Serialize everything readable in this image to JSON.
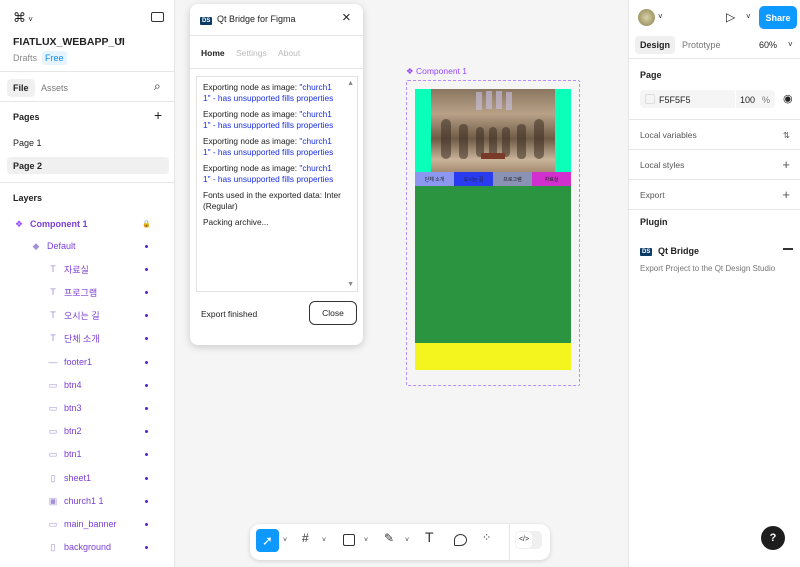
{
  "file": {
    "name": "FIATLUX_WEBAPP_UI",
    "location": "Drafts",
    "plan": "Free"
  },
  "left_tabs": {
    "file": "File",
    "assets": "Assets"
  },
  "pages": {
    "title": "Pages",
    "items": [
      "Page 1",
      "Page 2"
    ]
  },
  "layers": {
    "title": "Layers",
    "items": [
      {
        "name": "Component 1",
        "icon": "component-icon",
        "indent": 0
      },
      {
        "name": "Default",
        "icon": "variant-icon",
        "indent": 1
      },
      {
        "name": "자료실",
        "icon": "text-icon",
        "indent": 2
      },
      {
        "name": "프로그램",
        "icon": "text-icon",
        "indent": 2
      },
      {
        "name": "오시는 길",
        "icon": "text-icon",
        "indent": 2
      },
      {
        "name": "단체 소개",
        "icon": "text-icon",
        "indent": 2
      },
      {
        "name": "footer1",
        "icon": "line-icon",
        "indent": 2
      },
      {
        "name": "btn4",
        "icon": "rect-icon",
        "indent": 2
      },
      {
        "name": "btn3",
        "icon": "rect-icon",
        "indent": 2
      },
      {
        "name": "btn2",
        "icon": "rect-icon",
        "indent": 2
      },
      {
        "name": "btn1",
        "icon": "rect-icon",
        "indent": 2
      },
      {
        "name": "sheet1",
        "icon": "frame-icon",
        "indent": 2
      },
      {
        "name": "church1 1",
        "icon": "image-icon",
        "indent": 2
      },
      {
        "name": "main_banner",
        "icon": "rect-icon",
        "indent": 2
      },
      {
        "name": "background",
        "icon": "frame-icon",
        "indent": 2
      }
    ]
  },
  "plugin": {
    "title": "Qt Bridge for Figma",
    "tabs": [
      "Home",
      "Settings",
      "About"
    ],
    "log": [
      {
        "text": "Exporting node as image: ",
        "highlight": "\"church1 1\" - has unsupported fills properties"
      },
      {
        "text": "Exporting node as image: ",
        "highlight": "\"church1 1\" - has unsupported fills properties"
      },
      {
        "text": "Exporting node as image: ",
        "highlight": "\"church1 1\" - has unsupported fills properties"
      },
      {
        "text": "Exporting node as image: ",
        "highlight": "\"church1 1\" - has unsupported fills properties"
      },
      {
        "text": "Fonts used in the exported data: Inter (Regular)",
        "highlight": ""
      },
      {
        "text": "Packing archive...",
        "highlight": ""
      }
    ],
    "status": "Export finished",
    "close_label": "Close"
  },
  "canvas": {
    "component_label": "Component 1",
    "nav_buttons": [
      "단체 소개",
      "오시는 길",
      "프로그램",
      "자료실"
    ],
    "colors": {
      "banner": "#0affb9",
      "btn1": "#8c98f0",
      "btn2": "#2a3cf0",
      "btn3": "#8a93b5",
      "btn4": "#d22fcf",
      "sheet": "#2a9440",
      "footer": "#f4f51e"
    }
  },
  "right": {
    "share": "Share",
    "tabs": [
      "Design",
      "Prototype"
    ],
    "zoom": "60%",
    "page_title": "Page",
    "page_color": "F5F5F5",
    "opacity": "100",
    "opacity_unit": "%",
    "local_variables": "Local variables",
    "local_styles": "Local styles",
    "export": "Export",
    "plugin_title": "Plugin",
    "plugin_name": "Qt Bridge",
    "plugin_desc": "Export Project to the Qt Design Studio",
    "ds": "DS"
  },
  "help": "?"
}
